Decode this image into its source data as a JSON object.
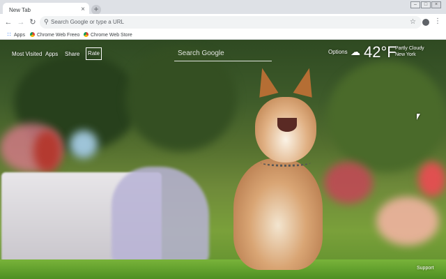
{
  "browser": {
    "tab_title": "New Tab",
    "tab_close": "×",
    "new_tab": "+",
    "omnibox_placeholder": "Search Google or type a URL",
    "bookmarks": [
      {
        "label": "Apps"
      },
      {
        "label": "Chrome Web Freeo"
      },
      {
        "label": "Chrome Web Store"
      }
    ]
  },
  "newtab": {
    "nav": {
      "most_visited": "Most Visited",
      "apps": "Apps",
      "share": "Share",
      "rate": "Rate"
    },
    "search_placeholder": "Search Google",
    "options": "Options",
    "weather": {
      "temperature": "42°F",
      "condition": "Partly Cloudy",
      "city": "New York"
    },
    "support": "Support"
  },
  "colors": {
    "chrome_tabstrip": "#dee1e6",
    "omnibox_bg": "#f1f3f4",
    "overlay_text": "#ffffff"
  }
}
